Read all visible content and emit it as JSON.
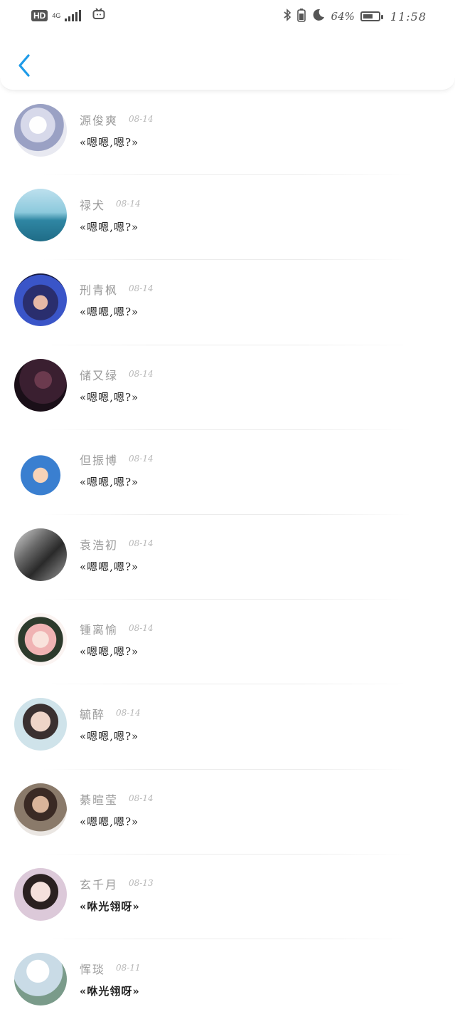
{
  "status_bar": {
    "hd": "HD",
    "network": "4G",
    "battery_percent": "64%",
    "battery_level": 0.64,
    "time": "11:58",
    "icons": [
      "signal-icon",
      "tv-icon",
      "bluetooth-icon",
      "battery-icon",
      "moon-icon"
    ]
  },
  "header": {
    "back_icon": "chevron-left-icon"
  },
  "colors": {
    "accent": "#1e9be8",
    "name": "#9a9a9a",
    "date": "#b8b8b8",
    "text": "#222222"
  },
  "messages": [
    {
      "name": "源俊爽",
      "date": "08-14",
      "text": "«嗯嗯,嗯?»"
    },
    {
      "name": "禄犬",
      "date": "08-14",
      "text": "«嗯嗯,嗯?»"
    },
    {
      "name": "刑青枫",
      "date": "08-14",
      "text": "«嗯嗯,嗯?»"
    },
    {
      "name": "储又绿",
      "date": "08-14",
      "text": "«嗯嗯,嗯?»"
    },
    {
      "name": "但振博",
      "date": "08-14",
      "text": "«嗯嗯,嗯?»"
    },
    {
      "name": "袁浩初",
      "date": "08-14",
      "text": "«嗯嗯,嗯?»"
    },
    {
      "name": "锺离愉",
      "date": "08-14",
      "text": "«嗯嗯,嗯?»"
    },
    {
      "name": "毓醉",
      "date": "08-14",
      "text": "«嗯嗯,嗯?»"
    },
    {
      "name": "綦暄莹",
      "date": "08-14",
      "text": "«嗯嗯,嗯?»"
    },
    {
      "name": "玄千月",
      "date": "08-13",
      "text": "«咻光翎呀»"
    },
    {
      "name": "恽琰",
      "date": "08-11",
      "text": "«咻光翎呀»"
    }
  ]
}
